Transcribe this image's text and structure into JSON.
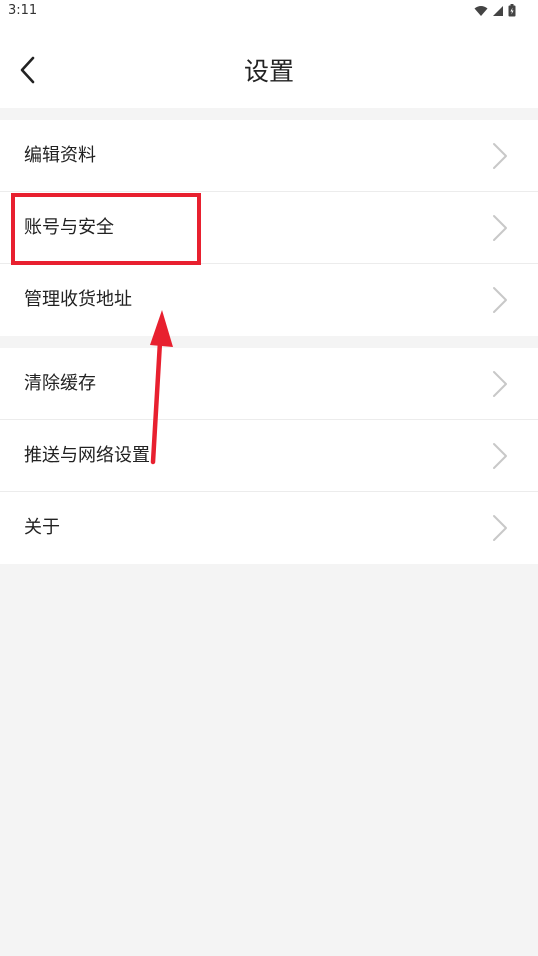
{
  "status_bar": {
    "time": "3:11",
    "icons": [
      "wifi-icon",
      "signal-icon",
      "battery-icon"
    ]
  },
  "header": {
    "title": "设置",
    "back_icon": "chevron-left-icon"
  },
  "groups": [
    {
      "items": [
        {
          "label": "编辑资料"
        },
        {
          "label": "账号与安全"
        },
        {
          "label": "管理收货地址"
        }
      ]
    },
    {
      "items": [
        {
          "label": "清除缓存"
        },
        {
          "label": "推送与网络设置"
        },
        {
          "label": "关于"
        }
      ]
    }
  ],
  "annotation": {
    "color": "#e8202f",
    "highlight_target": "账号与安全"
  },
  "colors": {
    "background": "#f4f4f4",
    "surface": "#ffffff",
    "chevron": "#c8c8c8",
    "divider": "#ececec"
  }
}
